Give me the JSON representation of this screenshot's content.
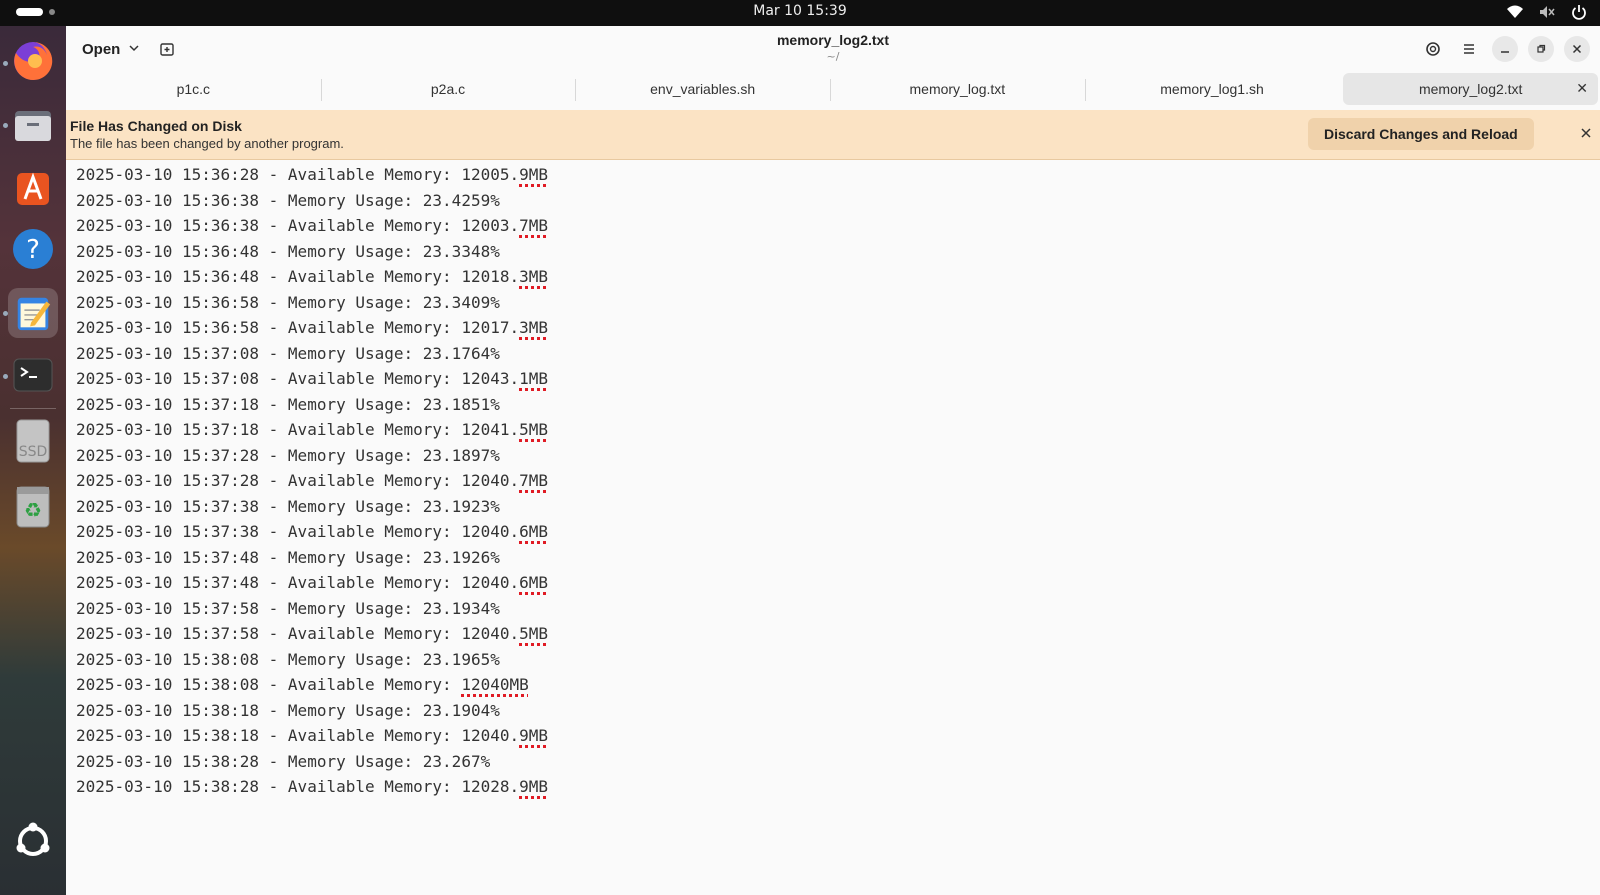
{
  "system": {
    "clock": "Mar 10  15:39",
    "tray_icons": [
      "wifi-icon",
      "speaker-muted-icon",
      "power-icon"
    ]
  },
  "dock": {
    "apps": [
      "firefox",
      "files",
      "app-center",
      "help",
      "text-editor",
      "terminal",
      "ssd-drive",
      "trash",
      "show-apps"
    ],
    "active": "text-editor",
    "ssd_label": "SSD"
  },
  "header": {
    "open_label": "Open",
    "title": "memory_log2.txt",
    "subtitle": "~/"
  },
  "tabs": [
    {
      "label": "p1c.c",
      "active": false
    },
    {
      "label": "p2a.c",
      "active": false
    },
    {
      "label": "env_variables.sh",
      "active": false
    },
    {
      "label": "memory_log.txt",
      "active": false
    },
    {
      "label": "memory_log1.sh",
      "active": false
    },
    {
      "label": "memory_log2.txt",
      "active": true
    }
  ],
  "infobar": {
    "title": "File Has Changed on Disk",
    "message": "The file has been changed by another program.",
    "reload_label": "Discard Changes and Reload",
    "bg": "#fbe3c4"
  },
  "editor": {
    "lines": [
      "2025-03-10 15:36:28 - Available Memory: 12005.9MB",
      "2025-03-10 15:36:38 - Memory Usage: 23.4259%",
      "2025-03-10 15:36:38 - Available Memory: 12003.7MB",
      "2025-03-10 15:36:48 - Memory Usage: 23.3348%",
      "2025-03-10 15:36:48 - Available Memory: 12018.3MB",
      "2025-03-10 15:36:58 - Memory Usage: 23.3409%",
      "2025-03-10 15:36:58 - Available Memory: 12017.3MB",
      "2025-03-10 15:37:08 - Memory Usage: 23.1764%",
      "2025-03-10 15:37:08 - Available Memory: 12043.1MB",
      "2025-03-10 15:37:18 - Memory Usage: 23.1851%",
      "2025-03-10 15:37:18 - Available Memory: 12041.5MB",
      "2025-03-10 15:37:28 - Memory Usage: 23.1897%",
      "2025-03-10 15:37:28 - Available Memory: 12040.7MB",
      "2025-03-10 15:37:38 - Memory Usage: 23.1923%",
      "2025-03-10 15:37:38 - Available Memory: 12040.6MB",
      "2025-03-10 15:37:48 - Memory Usage: 23.1926%",
      "2025-03-10 15:37:48 - Available Memory: 12040.6MB",
      "2025-03-10 15:37:58 - Memory Usage: 23.1934%",
      "2025-03-10 15:37:58 - Available Memory: 12040.5MB",
      "2025-03-10 15:38:08 - Memory Usage: 23.1965%",
      "2025-03-10 15:38:08 - Available Memory: 12040MB",
      "2025-03-10 15:38:18 - Memory Usage: 23.1904%",
      "2025-03-10 15:38:18 - Available Memory: 12040.9MB",
      "2025-03-10 15:38:28 - Memory Usage: 23.267%",
      "2025-03-10 15:38:28 - Available Memory: 12028.9MB"
    ],
    "spellcheck_color": "#e01b24"
  }
}
